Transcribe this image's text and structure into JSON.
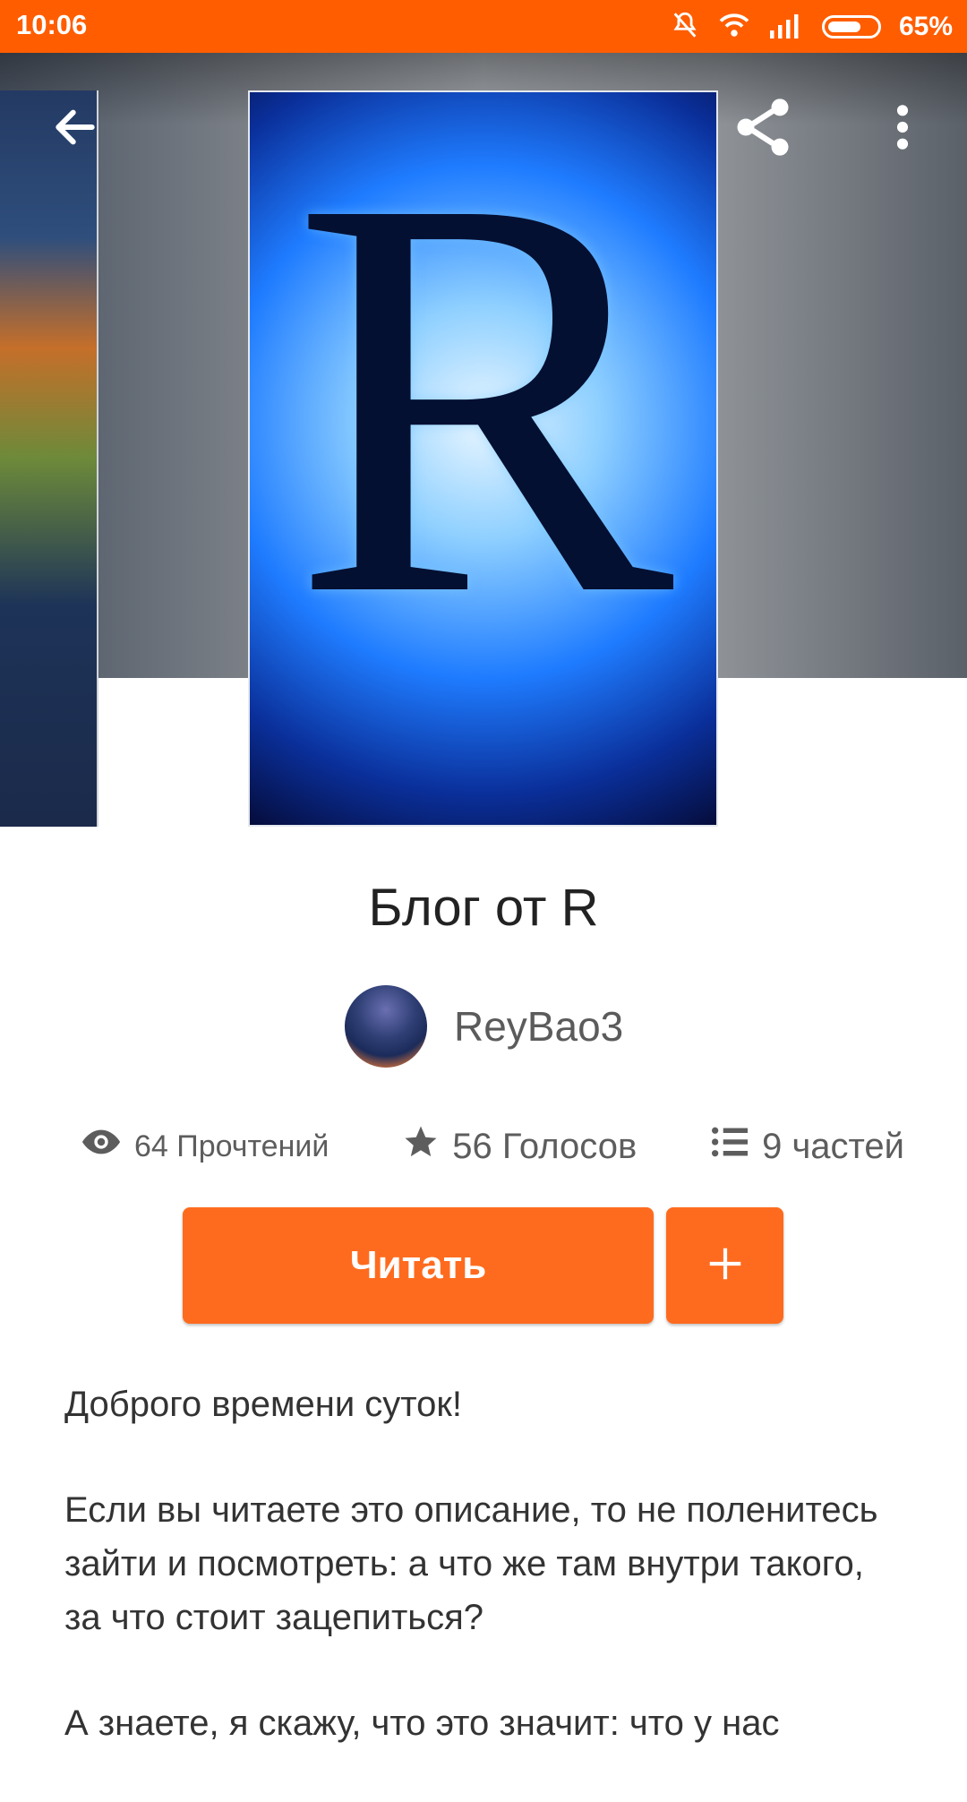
{
  "status_bar": {
    "time": "10:06",
    "battery": "65%"
  },
  "colors": {
    "accent": "#ff6b1e",
    "status_bar": "#ff5d00"
  },
  "toolbar": {
    "back_icon": "arrow-left",
    "share_icon": "share",
    "more_icon": "more-vertical"
  },
  "book": {
    "title": "Блог от R",
    "cover_letter": "R",
    "author": "ReyBao3"
  },
  "stats": {
    "reads": "64 Прочтений",
    "votes": "56 Голосов",
    "parts": "9 частей"
  },
  "actions": {
    "read_label": "Читать",
    "add_label": "+"
  },
  "description": {
    "p1": "Доброго времени суток!",
    "p2": "Если вы читаете это описание, то не поленитесь зайти и посмотреть: а что же там внутри такого, за что стоит зацепиться?",
    "p3": "А знаете, я скажу, что это значит: что у нас"
  }
}
